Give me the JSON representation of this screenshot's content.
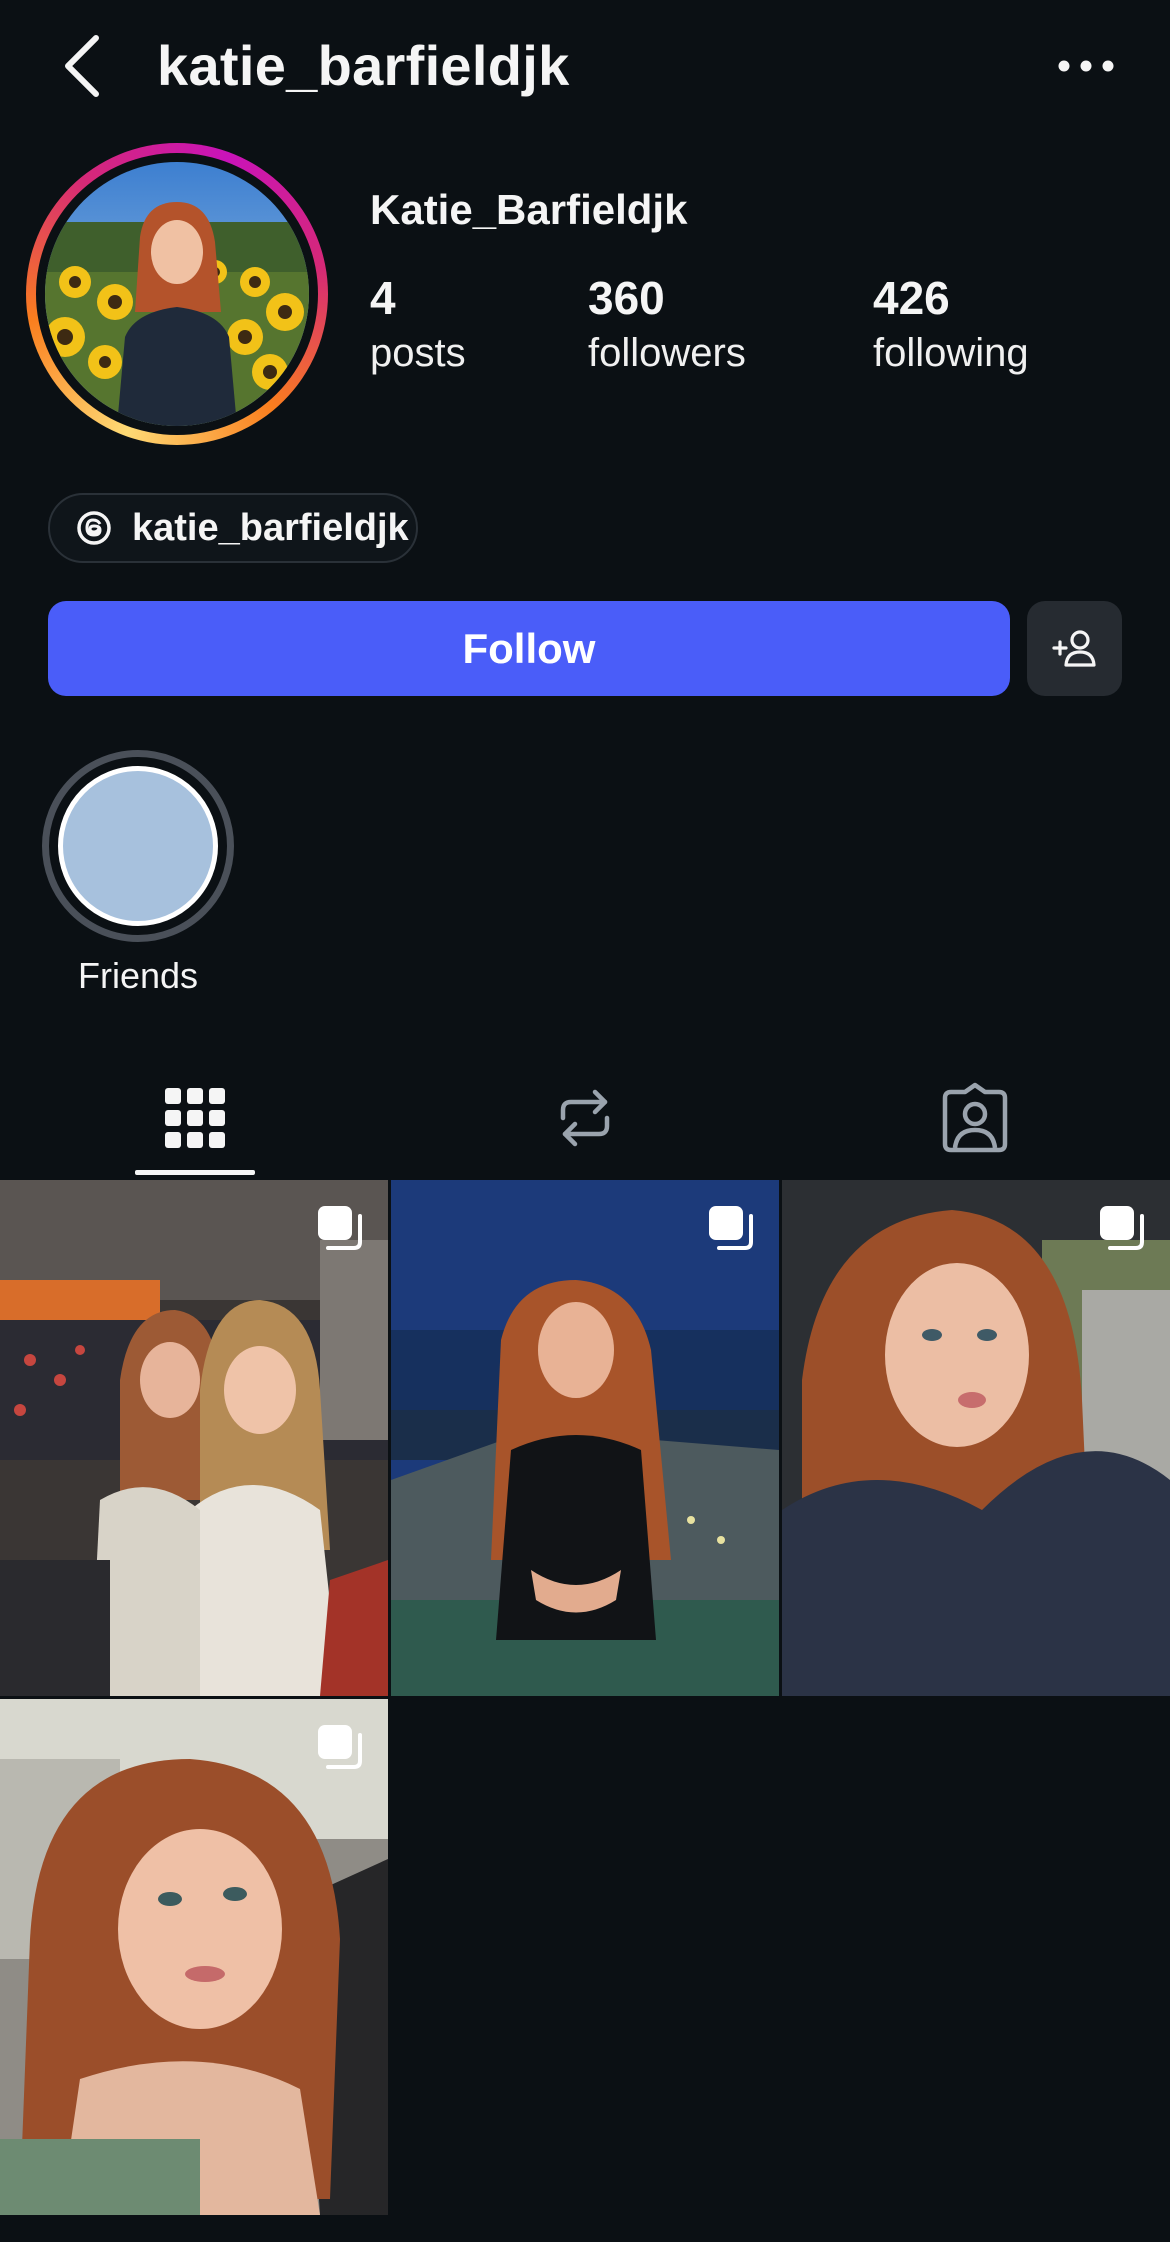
{
  "header": {
    "username": "katie_barfieldjk",
    "back_icon": "chevron-left-icon",
    "more_icon": "ellipsis-icon"
  },
  "profile": {
    "display_name": "Katie_Barfieldjk",
    "stats": {
      "posts": {
        "value": "4",
        "label": "posts"
      },
      "followers": {
        "value": "360",
        "label": "followers"
      },
      "following": {
        "value": "426",
        "label": "following"
      }
    },
    "threads_handle": "katie_barfieldjk"
  },
  "actions": {
    "follow_label": "Follow",
    "suggest_icon": "add-person-icon"
  },
  "highlights": [
    {
      "label": "Friends"
    }
  ],
  "tabs": [
    {
      "name": "posts-grid",
      "icon": "grid-icon",
      "active": true
    },
    {
      "name": "reposts",
      "icon": "repost-icon",
      "active": false
    },
    {
      "name": "tagged",
      "icon": "tagged-person-icon",
      "active": false
    }
  ],
  "posts": [
    {
      "type": "carousel"
    },
    {
      "type": "carousel"
    },
    {
      "type": "carousel"
    },
    {
      "type": "carousel"
    }
  ],
  "colors": {
    "background": "#0b1014",
    "follow_button": "#4a5df9",
    "secondary_button": "#262b31",
    "highlight_fill": "#a7c1dd"
  }
}
